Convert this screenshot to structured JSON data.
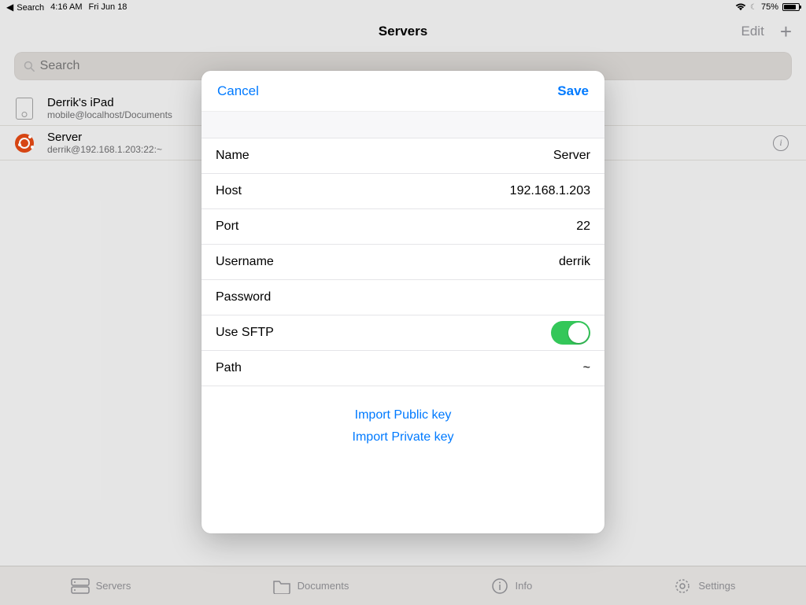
{
  "status": {
    "back_app": "Search",
    "time": "4:16 AM",
    "date": "Fri Jun 18",
    "battery_pct": "75%"
  },
  "nav": {
    "title": "Servers",
    "edit_label": "Edit"
  },
  "search": {
    "placeholder": "Search"
  },
  "servers": [
    {
      "title": "Derrik's iPad",
      "subtitle": "mobile@localhost/Documents"
    },
    {
      "title": "Server",
      "subtitle": "derrik@192.168.1.203:22:~"
    }
  ],
  "tabs": {
    "servers": "Servers",
    "documents": "Documents",
    "info": "Info",
    "settings": "Settings"
  },
  "modal": {
    "cancel": "Cancel",
    "save": "Save",
    "fields": {
      "name_label": "Name",
      "name_value": "Server",
      "host_label": "Host",
      "host_value": "192.168.1.203",
      "port_label": "Port",
      "port_value": "22",
      "username_label": "Username",
      "username_value": "derrik",
      "password_label": "Password",
      "password_value": "",
      "sftp_label": "Use SFTP",
      "sftp_on": true,
      "path_label": "Path",
      "path_value": "~"
    },
    "import_public": "Import Public key",
    "import_private": "Import Private key"
  }
}
